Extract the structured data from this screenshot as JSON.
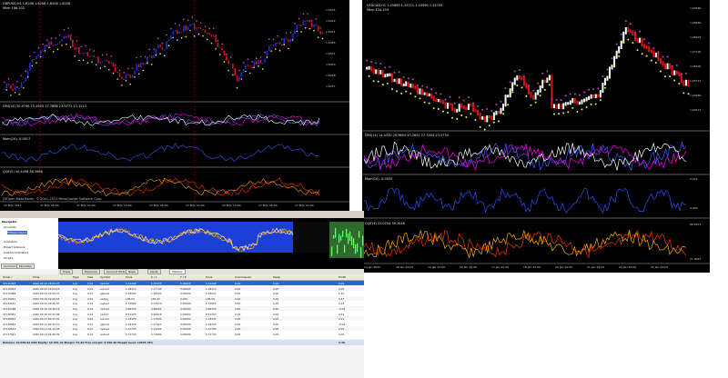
{
  "left_chart": {
    "header": "GBPUSD,H1  1.6208 1.6208 1.6208 1.6208",
    "subheader": "Mkm 196.202",
    "indicator1": "DMI(14) 20.9746 15.2505 27.7868 23.9771 13.3213",
    "indicator2": "Mom(10) -0.0017",
    "indicator3": "QQE(5) 54.4456 56.3968",
    "watermark": "FXOpen MetaTrader, © 2001-2011 MetaQuotes Software Corp.",
    "price_ticks": [
      "1.6434",
      "1.6422",
      "1.6391",
      "1.6365",
      "1.6337",
      "1.6303",
      "1.6268",
      "1.6237"
    ],
    "time_ticks": [
      "10 May 2011",
      "11 May 06:00",
      "11 May 22:00",
      "12 May 14:00",
      "13 May 06:00",
      "13 May 22:00",
      "16 May 14:00",
      "17 May 06:00",
      "17 May 22:00"
    ],
    "colors": {
      "bull": "#1a2ee6",
      "bear": "#e01010",
      "dots_top": "#d050d0",
      "dots_bottom": "#f0f060"
    }
  },
  "right_chart": {
    "header": "USDCAD,H1  1.25699 1.25711 1.25590 1.25705",
    "subheader": "Mkm 134.253",
    "indicator1": "DMI(14) 14.4330 25.9604 43.2651 27.3343 23.0734",
    "indicator2": "Mom(10) -0.0035",
    "indicator3": "QQE(4) 22.0204 39.2046",
    "price_ticks": [
      "1.29580",
      "1.28660",
      "1.28025",
      "1.27100",
      "1.26500",
      "1.25741",
      "1.24960",
      "1.24577"
    ],
    "osc_ticks": [
      "0.012",
      "0.000",
      "86.4973",
      "21.8057"
    ],
    "time_ticks": [
      "14 Jan 2022",
      "18 Jan 22:00",
      "14 Jan 22:00",
      "19 Jan 22:00",
      "17 Jan 22:00",
      "18 Jan 22:00",
      "20 Jan 22:00",
      "21 Jan 22:00",
      "24 Jan 22:00",
      "25 Jan 22:00"
    ],
    "colors": {
      "bull": "#ffffff",
      "bear": "#e01010",
      "dots_top": "#c040c0",
      "dots_bottom": "#f0f040"
    }
  },
  "terminal": {
    "navigator_title": "Navigator",
    "tree": [
      "Accounts",
      "FXOpen-Demo",
      "Indicators",
      "Expert Advisors",
      "Custom Indicators",
      "Scripts"
    ],
    "nav_tabs": [
      "Common",
      "Favorites"
    ],
    "tester_tabs": [
      "Trade",
      "Exposure",
      "Account History",
      "News",
      "Alerts",
      "Mailbox"
    ],
    "columns": [
      "Order /",
      "Time",
      "Type",
      "Size",
      "Symbol",
      "Price",
      "S / L",
      "T / P",
      "Price",
      "Commission",
      "Swap",
      "Profit"
    ],
    "rows": [
      [
        "47015404",
        "2020.09.10 18:52:07",
        "buy",
        "0.01",
        "usdcad",
        "1.31246",
        "1.30473",
        "0.00000",
        "1.31248",
        "0.00",
        "0.00",
        "0.02"
      ],
      [
        "47115034",
        "2020.09.10 19:04:16",
        "buy",
        "0.01",
        "eurusd",
        "1.18113",
        "1.17740",
        "0.00000",
        "1.18113",
        "0.00",
        "0.00",
        "0.00"
      ],
      [
        "47115888",
        "2020.09.10 19:55:27",
        "buy",
        "0.01",
        "gbpusd",
        "1.28201",
        "1.28103",
        "0.00000",
        "1.28221",
        "0.00",
        "0.00",
        "0.20"
      ],
      [
        "47115931",
        "2020.09.10 19:55:55",
        "buy",
        "0.01",
        "usdjpy",
        "106.03",
        "105.43",
        "0.000",
        "106.08",
        "0.00",
        "0.00",
        "0.47"
      ],
      [
        "47120241",
        "2020.09.10 20:26:07",
        "buy",
        "0.01",
        "audusd",
        "0.72800",
        "0.72570",
        "0.00000",
        "0.72815",
        "0.00",
        "0.00",
        "0.15"
      ],
      [
        "47120398",
        "2020.09.10 20:46:19",
        "buy",
        "0.01",
        "nzdusd",
        "0.66753",
        "0.66602",
        "0.00000",
        "0.66750",
        "0.00",
        "0.00",
        "-0.03"
      ],
      [
        "47120461",
        "2020.09.10 20:52:08",
        "buy",
        "0.01",
        "usdchf",
        "0.91125",
        "0.90918",
        "0.00000",
        "0.91153",
        "0.00",
        "0.00",
        "0.31"
      ],
      [
        "47128653",
        "2020.09.11 00:21:50",
        "buy",
        "0.01",
        "eurusd",
        "1.18120",
        "1.17900",
        "0.00000",
        "1.18141",
        "0.00",
        "0.00",
        "0.21"
      ],
      [
        "47128662",
        "2020.09.11 00:22:10",
        "buy",
        "0.01",
        "gbpusd",
        "1.28126",
        "1.27923",
        "0.00000",
        "1.28124",
        "0.00",
        "0.00",
        "-0.02"
      ],
      [
        "47136551",
        "2020.09.11 04:10:45",
        "buy",
        "0.01",
        "usdcad",
        "1.31755",
        "1.31502",
        "0.00000",
        "1.31760",
        "0.00",
        "0.00",
        "0.04"
      ],
      [
        "47137021",
        "2020.09.11 04:26:01",
        "buy",
        "0.01",
        "audusd",
        "0.72724",
        "0.72600",
        "0.00000",
        "0.72730",
        "0.00",
        "0.00",
        "0.06"
      ]
    ],
    "balance_line": "Balance: 10 038.92 USD  Equity: 10 041.32  Margin: 51.02  Free margin: 9 990.30  Margin level: 19676.78%",
    "balance_total": "2.40"
  }
}
